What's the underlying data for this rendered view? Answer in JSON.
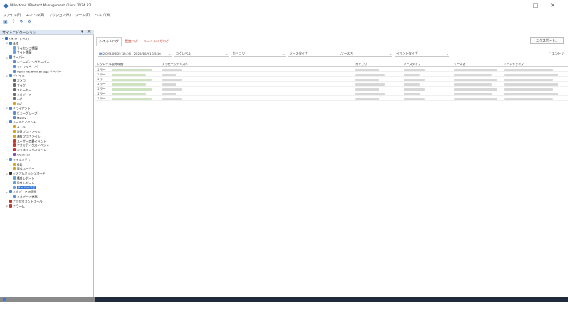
{
  "window": {
    "title": "Milestone XProtect Management Client 2024 R2",
    "minimize": "—",
    "maximize": "□",
    "close": "✕"
  },
  "menu": [
    "ファイル(F)",
    "エンドル(E)",
    "アクション(A)",
    "ツール(T)",
    "ヘルプ(H)"
  ],
  "toolbar": {
    "icons": [
      "save-icon",
      "help-icon",
      "refresh-icon",
      "settings-icon"
    ]
  },
  "sidebar": {
    "title": "サイトナビゲーション",
    "pin": "▾",
    "close": "✕",
    "items": [
      {
        "indent": 0,
        "label": "CN16 - (14.1)",
        "color": "#2f6db5",
        "exp": "⊟"
      },
      {
        "indent": 1,
        "label": "基本",
        "color": "#4a86c8",
        "exp": "⊟"
      },
      {
        "indent": 2,
        "label": "ライセンス情報",
        "color": "#6aa0d8",
        "exp": ""
      },
      {
        "indent": 2,
        "label": "サイト情報",
        "color": "#6aa0d8",
        "exp": ""
      },
      {
        "indent": 1,
        "label": "サーバー",
        "color": "#4a86c8",
        "exp": "⊟"
      },
      {
        "indent": 2,
        "label": "レコーディングサーバー",
        "color": "#5a8fcb",
        "exp": ""
      },
      {
        "indent": 2,
        "label": "モバイルサーバー",
        "color": "#5a8fcb",
        "exp": ""
      },
      {
        "indent": 2,
        "label": "Open Network Bridge サーバー",
        "color": "#5a8fcb",
        "exp": ""
      },
      {
        "indent": 1,
        "label": "デバイス",
        "color": "#4a86c8",
        "exp": "⊟"
      },
      {
        "indent": 2,
        "label": "カメラ",
        "color": "#6b6b6b",
        "exp": ""
      },
      {
        "indent": 2,
        "label": "マイク",
        "color": "#6b6b6b",
        "exp": ""
      },
      {
        "indent": 2,
        "label": "スピーカー",
        "color": "#6b6b6b",
        "exp": ""
      },
      {
        "indent": 2,
        "label": "メタデータ",
        "color": "#6b6b6b",
        "exp": ""
      },
      {
        "indent": 2,
        "label": "入力",
        "color": "#6b6b6b",
        "exp": ""
      },
      {
        "indent": 2,
        "label": "出力",
        "color": "#d8a21f",
        "exp": ""
      },
      {
        "indent": 1,
        "label": "クライアント",
        "color": "#4a86c8",
        "exp": "⊟"
      },
      {
        "indent": 2,
        "label": "ビューグループ",
        "color": "#5a8fcb",
        "exp": ""
      },
      {
        "indent": 2,
        "label": "Matrix",
        "color": "#5a8fcb",
        "exp": ""
      },
      {
        "indent": 1,
        "label": "ルールとイベント",
        "color": "#4a86c8",
        "exp": "⊟"
      },
      {
        "indent": 2,
        "label": "ルール",
        "color": "#d8a21f",
        "exp": ""
      },
      {
        "indent": 2,
        "label": "時間プロファイル",
        "color": "#d8a21f",
        "exp": ""
      },
      {
        "indent": 2,
        "label": "通知プロファイル",
        "color": "#d8a21f",
        "exp": ""
      },
      {
        "indent": 2,
        "label": "ユーザー定義イベント",
        "color": "#c0392b",
        "exp": ""
      },
      {
        "indent": 2,
        "label": "アナリティクスイベント",
        "color": "#c0392b",
        "exp": ""
      },
      {
        "indent": 2,
        "label": "ジェネリックイベント",
        "color": "#c0392b",
        "exp": ""
      },
      {
        "indent": 2,
        "label": "Webhook",
        "color": "#8e44ad",
        "exp": ""
      },
      {
        "indent": 1,
        "label": "セキュリティ",
        "color": "#4a86c8",
        "exp": "⊟"
      },
      {
        "indent": 2,
        "label": "役割",
        "color": "#d8a21f",
        "exp": ""
      },
      {
        "indent": 2,
        "label": "基本ユーザー",
        "color": "#d8a21f",
        "exp": ""
      },
      {
        "indent": 1,
        "label": "システムダッシュボード",
        "color": "#333333",
        "exp": "⊟"
      },
      {
        "indent": 2,
        "label": "構成レポート",
        "color": "#6aa0d8",
        "exp": ""
      },
      {
        "indent": 2,
        "label": "設定レポート",
        "color": "#6aa0d8",
        "exp": ""
      },
      {
        "indent": 2,
        "label": "サーバーログ",
        "color": "#6aa0d8",
        "exp": "",
        "selected": true
      },
      {
        "indent": 1,
        "label": "メタデータの使用",
        "color": "#4a86c8",
        "exp": "⊟"
      },
      {
        "indent": 2,
        "label": "メタデータ検索",
        "color": "#5a8fcb",
        "exp": ""
      },
      {
        "indent": 1,
        "label": "アクセスコントロール",
        "color": "#c0392b",
        "exp": ""
      },
      {
        "indent": 1,
        "label": "アラーム",
        "color": "#c0392b",
        "exp": "⊞"
      }
    ]
  },
  "main": {
    "tabs": [
      {
        "label": "システムログ",
        "active": true
      },
      {
        "label": "監査ログ",
        "active": false
      },
      {
        "label": "ルールトリガログ",
        "active": false
      }
    ],
    "export_label": "エクスポート...",
    "count_label": "7 エントリ",
    "filters": [
      {
        "label": "2025/09/25 15:16 - 2025/10/01 15:16",
        "icon": "calendar-icon"
      },
      {
        "label": "ログレベル"
      },
      {
        "label": "カテゴリ"
      },
      {
        "label": "ソースタイプ"
      },
      {
        "label": "ソース名"
      },
      {
        "label": "イベントタイプ"
      }
    ],
    "columns": [
      "ログレベル",
      "現地時間",
      "メッセージテキスト",
      "カテゴリ",
      "ソースタイプ",
      "ソース名",
      "イベントタイプ"
    ],
    "rows": [
      {
        "level": "エラー"
      },
      {
        "level": "エラー"
      },
      {
        "level": "エラー"
      },
      {
        "level": "エラー"
      },
      {
        "level": "エラー"
      },
      {
        "level": "エラー"
      },
      {
        "level": "エラー"
      }
    ]
  }
}
